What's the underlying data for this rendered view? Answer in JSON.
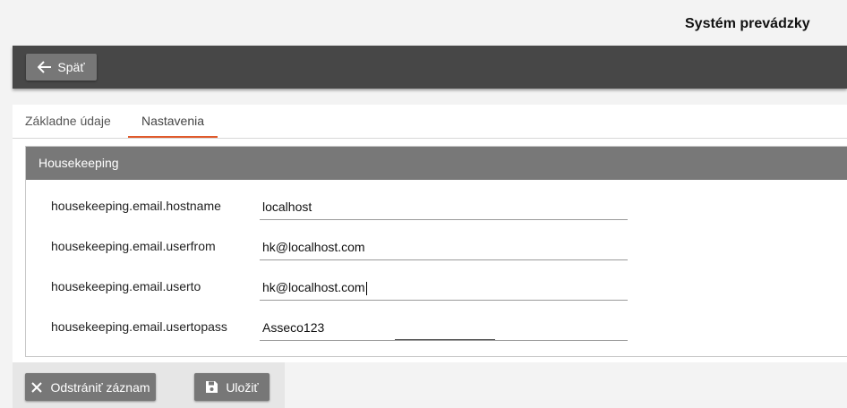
{
  "header": {
    "title": "Systém prevádzky"
  },
  "toolbar": {
    "back_label": "Späť",
    "back_icon": "arrow-left-icon"
  },
  "tabs": [
    {
      "label": "Základne údaje",
      "active": false
    },
    {
      "label": "Nastavenia",
      "active": true
    }
  ],
  "group": {
    "title": "Housekeeping",
    "fields": [
      {
        "label": "housekeeping.email.hostname",
        "value": "localhost"
      },
      {
        "label": "housekeeping.email.userfrom",
        "value": "hk@localhost.com"
      },
      {
        "label": "housekeeping.email.userto",
        "value": "hk@localhost.com"
      },
      {
        "label": "housekeeping.email.usertopass",
        "value": "Asseco123"
      }
    ]
  },
  "footer": {
    "delete_label": "Odstrániť záznam",
    "delete_icon": "close-icon",
    "save_label": "Uložiť",
    "save_icon": "floppy-disk-icon"
  },
  "colors": {
    "topbar": "#474747",
    "button": "#777777",
    "tab_accent": "#e05a2b",
    "group_header": "#787878"
  }
}
